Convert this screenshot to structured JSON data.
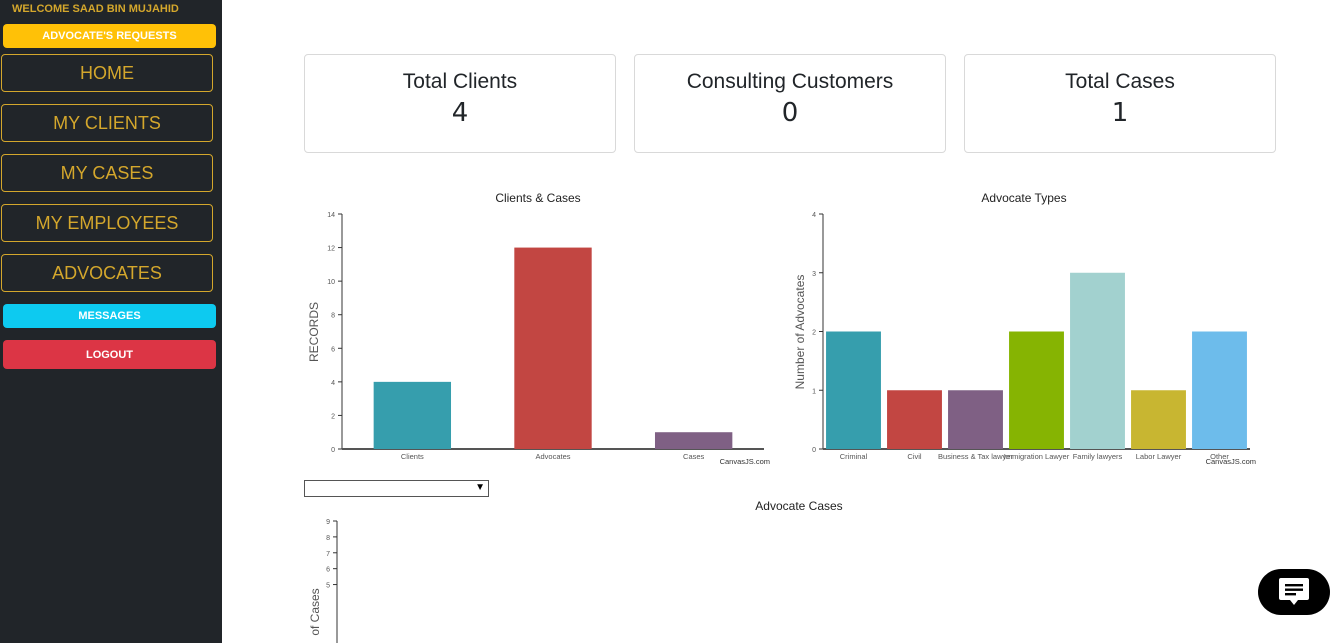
{
  "sidebar": {
    "welcome": "WELCOME SAAD BIN MUJAHID",
    "requests": "ADVOCATE'S REQUESTS",
    "nav": [
      "HOME",
      "MY CLIENTS",
      "MY CASES",
      "MY EMPLOYEES",
      "ADVOCATES"
    ],
    "messages": "MESSAGES",
    "logout": "LOGOUT"
  },
  "cards": [
    {
      "title": "Total Clients",
      "value": "4"
    },
    {
      "title": "Consulting Customers",
      "value": "0"
    },
    {
      "title": "Total Cases",
      "value": "1"
    }
  ],
  "chart_data": [
    {
      "type": "bar",
      "title": "Clients & Cases",
      "ylabel": "RECORDS",
      "xlabel": "",
      "categories": [
        "Clients",
        "Advocates",
        "Cases"
      ],
      "values": [
        4,
        12,
        1
      ],
      "colors": [
        "#369ead",
        "#c24642",
        "#7f6084"
      ],
      "ylim": [
        0,
        14
      ],
      "yticks": [
        0,
        2,
        4,
        6,
        8,
        10,
        12,
        14
      ],
      "credit": "CanvasJS.com"
    },
    {
      "type": "bar",
      "title": "Advocate Types",
      "ylabel": "Number of Advocates",
      "xlabel": "",
      "categories": [
        "Criminal",
        "Civil",
        "Business & Tax lawyer",
        "Immigration Lawyer",
        "Family lawyers",
        "Labor Lawyer",
        "Other"
      ],
      "values": [
        2,
        1,
        1,
        2,
        3,
        1,
        2
      ],
      "colors": [
        "#369ead",
        "#c24642",
        "#7f6084",
        "#86b402",
        "#a2d1cf",
        "#c8b631",
        "#6dbceb"
      ],
      "ylim": [
        0,
        4
      ],
      "yticks": [
        0,
        1,
        2,
        3,
        4
      ],
      "credit": "CanvasJS.com"
    },
    {
      "type": "bar",
      "title": "Advocate Cases",
      "ylabel": "of Cases",
      "xlabel": "",
      "categories": [],
      "values": [],
      "ylim": [
        0,
        9
      ],
      "yticks": [
        5,
        6,
        7,
        8,
        9
      ]
    }
  ],
  "select": {
    "value": ""
  },
  "icons": {
    "chat": "chat-icon"
  }
}
